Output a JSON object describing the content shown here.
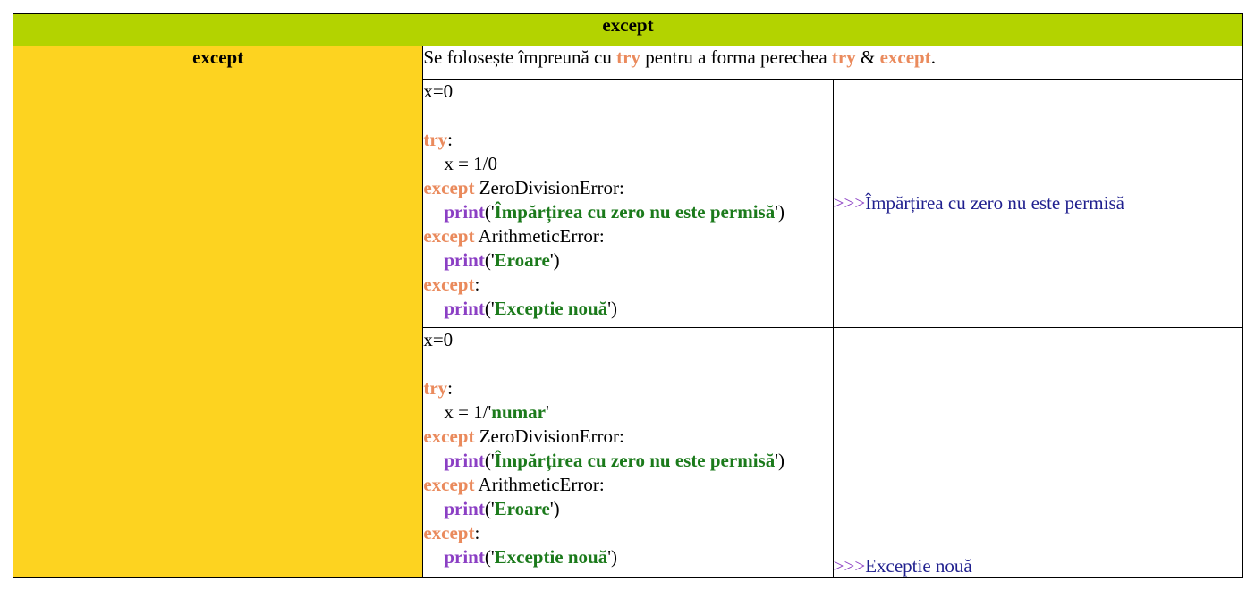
{
  "header": {
    "title": "except",
    "color": "#b3d300"
  },
  "side": {
    "label": "except",
    "color": "#fdd320"
  },
  "description": {
    "text1": "Se folosește împreună cu ",
    "kw1": "try",
    "text2": " pentru a forma perechea ",
    "kw2": "try",
    "text3": " & ",
    "kw3": "except",
    "text4": "."
  },
  "example1": {
    "l1": "x=0",
    "try": "try",
    "colon": ":",
    "assign": "x = 1/0",
    "exc1": "except",
    "exc1_name": " ZeroDivisionError:",
    "print": "print",
    "q_open": "('",
    "msg1": "Împărțirea cu zero nu este permisă",
    "q_close": "')",
    "exc2": "except",
    "exc2_name": " ArithmeticError:",
    "msg2": "Eroare",
    "exc3": "except",
    "msg3": "Exceptie nouă",
    "output_prompt": ">>>",
    "output": "Împărțirea cu zero nu este permisă"
  },
  "example2": {
    "l1": "x=0",
    "try": "try",
    "colon": ":",
    "assign_pre": "x = 1/'",
    "assign_str": "numar",
    "assign_post": "'",
    "exc1": "except",
    "exc1_name": " ZeroDivisionError:",
    "print": "print",
    "q_open": "('",
    "msg1": "Împărțirea cu zero nu este permisă",
    "q_close": "')",
    "exc2": "except",
    "exc2_name": " ArithmeticError:",
    "msg2": "Eroare",
    "exc3": "except",
    "msg3": "Exceptie nouă",
    "output_prompt": ">>>",
    "output": "Exceptie nouă"
  }
}
